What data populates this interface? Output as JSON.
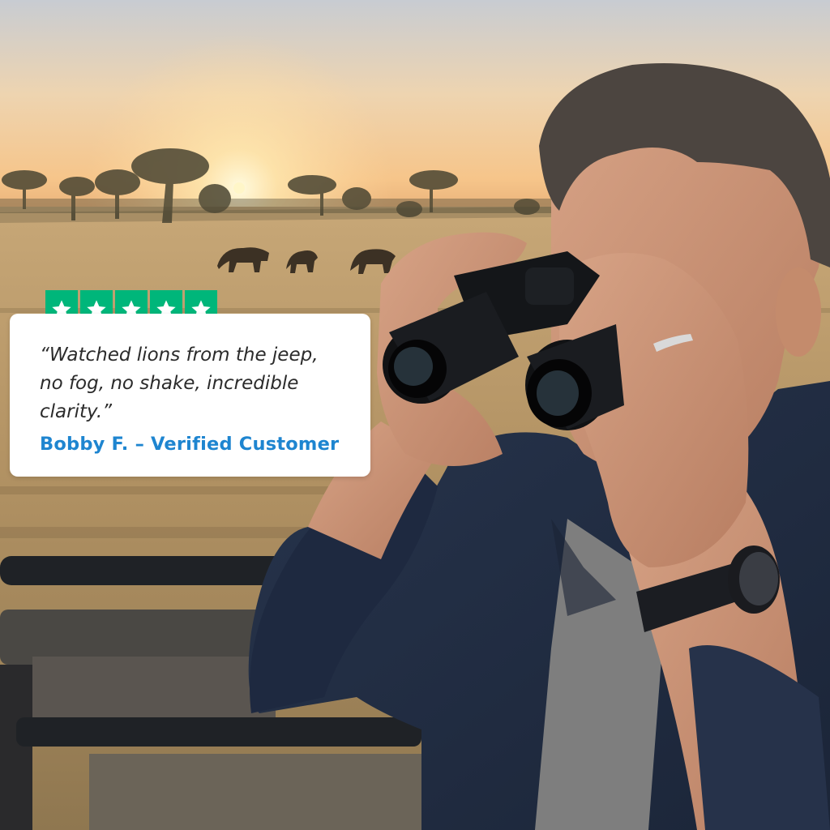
{
  "review": {
    "stars": 5,
    "quote": "“Watched lions from the jeep, no fog, no shake, incredible clarity.”",
    "author": "Bobby F. – Verified Customer"
  },
  "colors": {
    "star_bg": "#00b67a",
    "author_text": "#1e85d0",
    "sky_top": "#c9cdd4",
    "sun": "#fff6c8"
  },
  "icons": [
    "star-icon"
  ]
}
